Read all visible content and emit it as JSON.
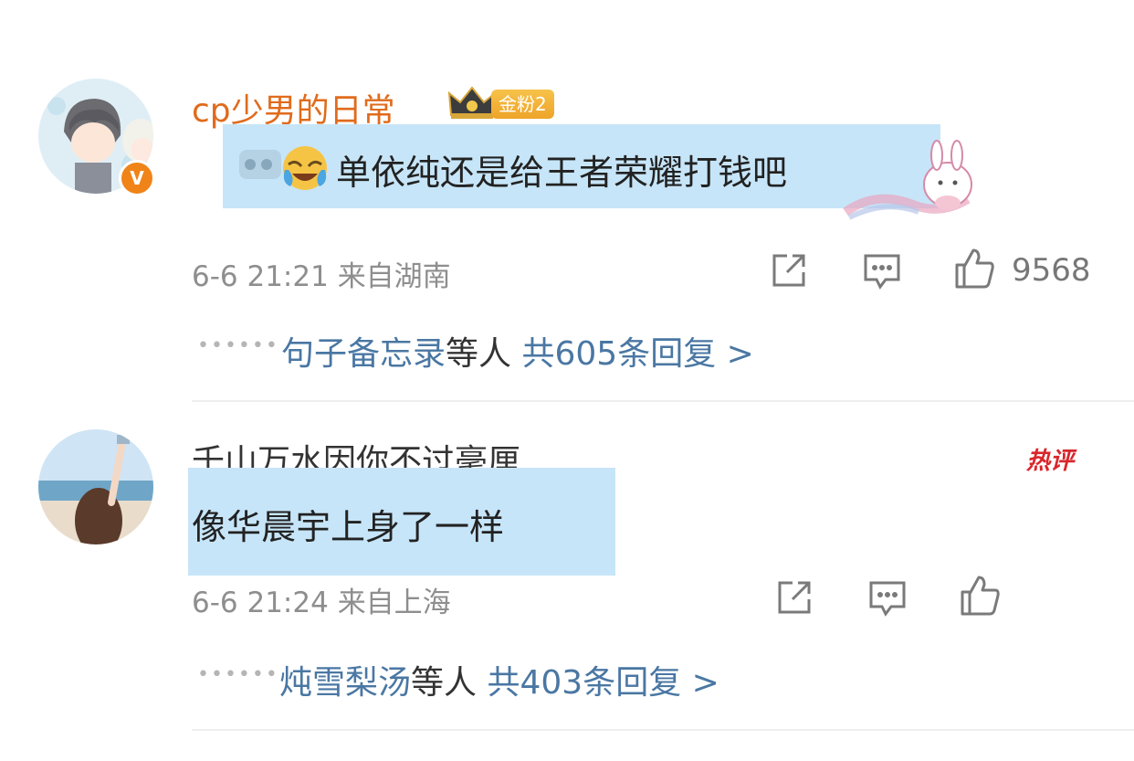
{
  "colors": {
    "username_orange": "#e06b1c",
    "reply_link_blue": "#4a77a3",
    "highlight": "#c7e5f8",
    "hot_red": "#d9262b"
  },
  "comments": [
    {
      "username": "cp少男的日常",
      "verified_badge": "V",
      "fan_badge": "金粉2",
      "text": "单依纯还是给王者荣耀打钱吧",
      "time": "6-6 21:21",
      "location": "来自湖南",
      "likes": "9568",
      "reply_names": "句子备忘录",
      "reply_mid": "等人",
      "reply_count": "共605条回复 >",
      "icons": [
        "share-icon",
        "comment-icon",
        "thumbs-up-icon"
      ]
    },
    {
      "username": "千山万水因你不过毫厘",
      "text": "像华晨宇上身了一样",
      "time": "6-6 21:24",
      "location": "来自上海",
      "tag": "热评",
      "reply_names": "炖雪梨汤",
      "reply_mid": "等人",
      "reply_count": "共403条回复 >",
      "icons": [
        "share-icon",
        "comment-icon",
        "thumbs-up-icon"
      ]
    }
  ]
}
